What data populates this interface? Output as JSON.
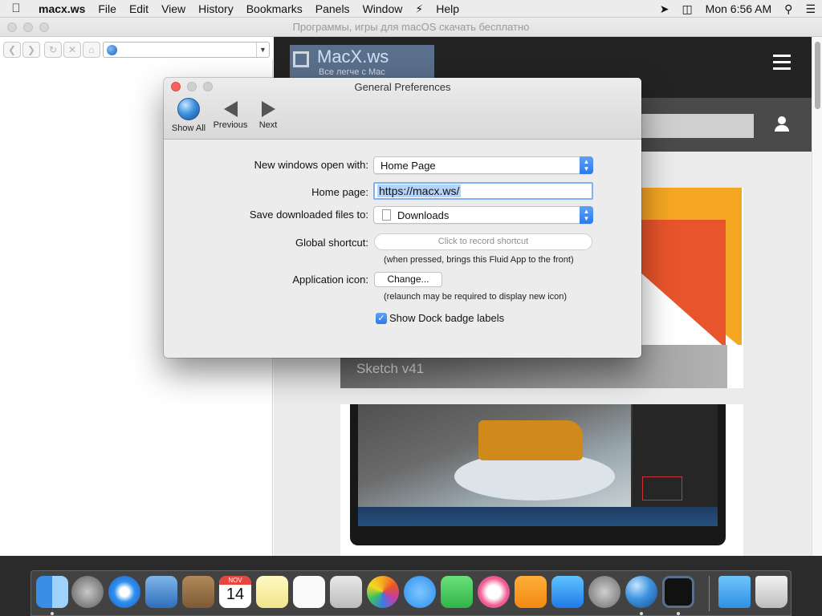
{
  "menubar": {
    "app_name": "macx.ws",
    "items": [
      "File",
      "Edit",
      "View",
      "History",
      "Bookmarks",
      "Panels",
      "Window",
      "Help"
    ],
    "clock": "Mon 6:56 AM"
  },
  "browser": {
    "window_title": "Программы, игры для macOS скачать бесплатно",
    "url": ""
  },
  "web": {
    "logo_name": "MacX.ws",
    "logo_tagline": "Все легче с Mac",
    "card1_caption": "Sketch v41"
  },
  "prefs": {
    "title": "General Preferences",
    "toolbar": {
      "show_all": "Show All",
      "previous": "Previous",
      "next": "Next"
    },
    "new_windows_label": "New windows open with:",
    "new_windows_value": "Home Page",
    "home_page_label": "Home page:",
    "home_page_value": "https://macx.ws/",
    "save_downloads_label": "Save downloaded files to:",
    "save_downloads_value": "Downloads",
    "global_shortcut_label": "Global shortcut:",
    "global_shortcut_placeholder": "Click to record shortcut",
    "global_shortcut_hint": "(when pressed, brings this Fluid App to the front)",
    "app_icon_label": "Application icon:",
    "change_button": "Change...",
    "app_icon_hint": "(relaunch may be required to display new icon)",
    "dock_badge_label": "Show Dock badge labels",
    "dock_badge_checked": true
  },
  "dock": {
    "calendar_month": "NOV",
    "calendar_day": "14",
    "apps": [
      "Finder",
      "Launchpad",
      "Safari",
      "Mail",
      "Contacts",
      "Calendar",
      "Notes",
      "Reminders",
      "Preview",
      "Photos",
      "Messages",
      "FaceTime",
      "iTunes",
      "iBooks",
      "App Store",
      "System Preferences",
      "Fluid",
      "MacX.ws",
      "Downloads",
      "Trash"
    ]
  }
}
